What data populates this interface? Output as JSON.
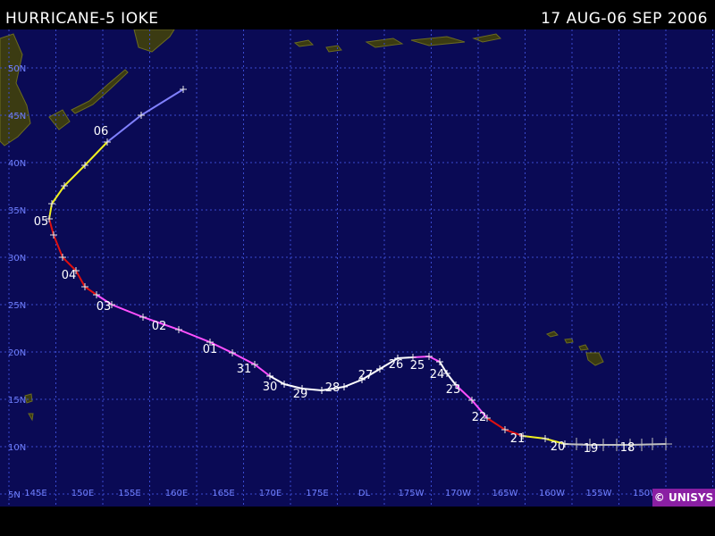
{
  "header": {
    "title": "HURRICANE-5 IOKE",
    "date_range": "17 AUG-06 SEP 2006"
  },
  "map": {
    "background": "#0a0a55",
    "grid_color": "#3a4bd0",
    "land_color": "#3b3b12",
    "lat_labels": [
      "50N",
      "45N",
      "40N",
      "35N",
      "30N",
      "25N",
      "20N",
      "15N",
      "10N",
      "5N"
    ],
    "lon_labels": [
      "145E",
      "150E",
      "155E",
      "160E",
      "165E",
      "170E",
      "175E",
      "DL",
      "175W",
      "170W",
      "165W",
      "160W",
      "155W",
      "150W"
    ]
  },
  "track": {
    "colors": {
      "depression": "#c0c0c0",
      "storm": "#f0f020",
      "cat1": "#e01010",
      "cat4": "#ff50ff",
      "cat5": "#ffffff",
      "extratropical": "#8080ff"
    },
    "day_labels": [
      "18",
      "19",
      "20",
      "21",
      "22",
      "23",
      "24",
      "25",
      "26",
      "27",
      "28",
      "29",
      "30",
      "31",
      "01",
      "02",
      "03",
      "04",
      "05",
      "06"
    ]
  },
  "footer": {
    "credit": "© UNISYS"
  }
}
